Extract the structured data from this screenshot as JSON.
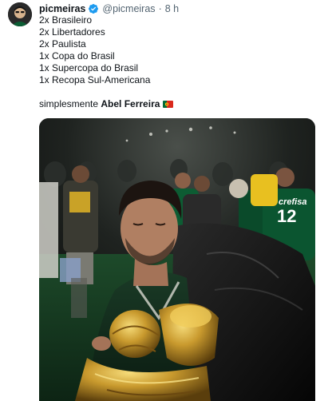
{
  "tweet": {
    "author_name": "picmeiras",
    "handle": "@picmeiras",
    "separator": "·",
    "time": "8 h",
    "lines": [
      "2x Brasileiro",
      "2x Libertadores",
      "2x Paulista",
      "1x Copa do Brasil",
      "1x Supercopa do Brasil",
      "1x Recopa Sul-Americana"
    ],
    "caption_prefix": "simplesmente ",
    "caption_name": "Abel Ferreira",
    "flag_icon": "portugal-flag-icon",
    "photo": {
      "shirt_sponsor": "crefisa",
      "shirt_number": "12"
    }
  },
  "colors": {
    "text_primary": "#0f1419",
    "text_secondary": "#536471",
    "verified_blue": "#1d9bf0",
    "palmeiras_green": "#0a4a2a"
  }
}
